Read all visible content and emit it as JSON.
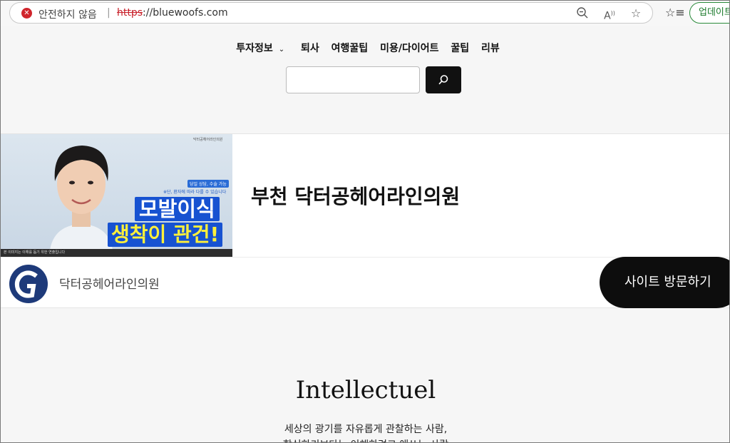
{
  "browser": {
    "security_label": "안전하지 않음",
    "separator": "|",
    "url_scheme": "https",
    "url_rest": "://bluewoofs.com",
    "update_label": "업데이트"
  },
  "nav": {
    "items": [
      "투자정보",
      "퇴사",
      "여행꿀팁",
      "미용/다이어트",
      "꿀팁",
      "리뷰"
    ],
    "dropdown_index": 0
  },
  "search": {
    "placeholder": ""
  },
  "ad": {
    "image_text": {
      "brand_top": "닥터공헤어라인의원",
      "badge": "당일 상담, 수술 가능",
      "note": "※단, 환자에 따라 다를 수 있습니다",
      "line1": "모발이식",
      "line2": "생착이 관건!",
      "bottom_strip": "본 이미지는 이해를 돕기 위한 연출입니다"
    },
    "title": "부천 닥터공헤어라인의원",
    "advertiser": "닥터공헤어라인의원",
    "visit_label": "사이트 방문하기"
  },
  "site": {
    "title": "Intellectuel",
    "tagline_line1": "세상의 광기를 자유롭게 관찰하는 사람,",
    "tagline_line2": "학식하기보다는 이해하려고 애쓰는 사람"
  }
}
